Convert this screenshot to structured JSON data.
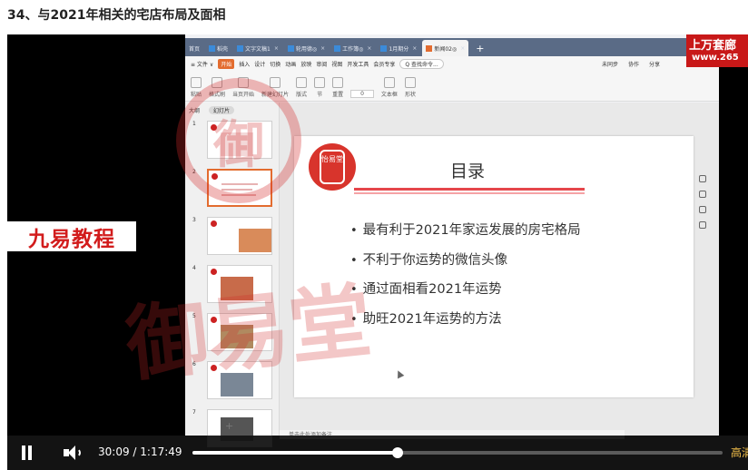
{
  "page": {
    "heading": "34、与2021年相关的宅店布局及面相"
  },
  "overlays": {
    "brand_left": "九易教程",
    "brand_top_line1": "上万套廊",
    "brand_top_line2": "www.265",
    "watermark": "御易堂"
  },
  "app": {
    "tabs": [
      {
        "label": "首页",
        "close": ""
      },
      {
        "label": "稻壳",
        "close": ""
      },
      {
        "label": "文字文稿1",
        "close": "×"
      },
      {
        "label": "轮用德◎",
        "close": "×"
      },
      {
        "label": "工作簿◎",
        "close": "×"
      },
      {
        "label": "1月期分",
        "close": "×"
      },
      {
        "label": "新闻02◎",
        "close": "×"
      }
    ],
    "new_tab": "+",
    "menu": {
      "file": "≡ 文件 ∨",
      "items": [
        "开始",
        "插入",
        "设计",
        "切换",
        "动画",
        "放映",
        "审阅",
        "视图",
        "开发工具",
        "会员专享"
      ],
      "search": "Q 查找命令...",
      "right": [
        "未同步",
        "协作",
        "分享"
      ]
    },
    "ribbon": [
      "粘贴",
      "格式刷",
      "当页开始",
      "新建幻灯片",
      "版式",
      "节",
      "重置",
      "文本框",
      "形状"
    ],
    "font_size": "0",
    "side_panel": {
      "outline_tab": "大纲",
      "slides_tab": "幻灯片",
      "slide_numbers": [
        "1",
        "2",
        "3",
        "4",
        "5",
        "6",
        "7"
      ],
      "add": "+"
    },
    "slide": {
      "seal_text": "怡易堂",
      "title": "目录",
      "bullets": [
        "最有利于2021年家运发展的房宅格局",
        "不利于你运势的微信头像",
        "通过面相看2021年运势",
        "助旺2021年运势的方法"
      ]
    },
    "notes": "单击此处添加备注"
  },
  "player": {
    "current_time": "30:09",
    "separator": "/",
    "duration": "1:17:49",
    "progress_fraction": 0.387,
    "quality": "高清",
    "colors": {
      "progress_fill": "#ffffff",
      "progress_track": "#5b5b5b",
      "quality": "#f5c14a"
    }
  }
}
